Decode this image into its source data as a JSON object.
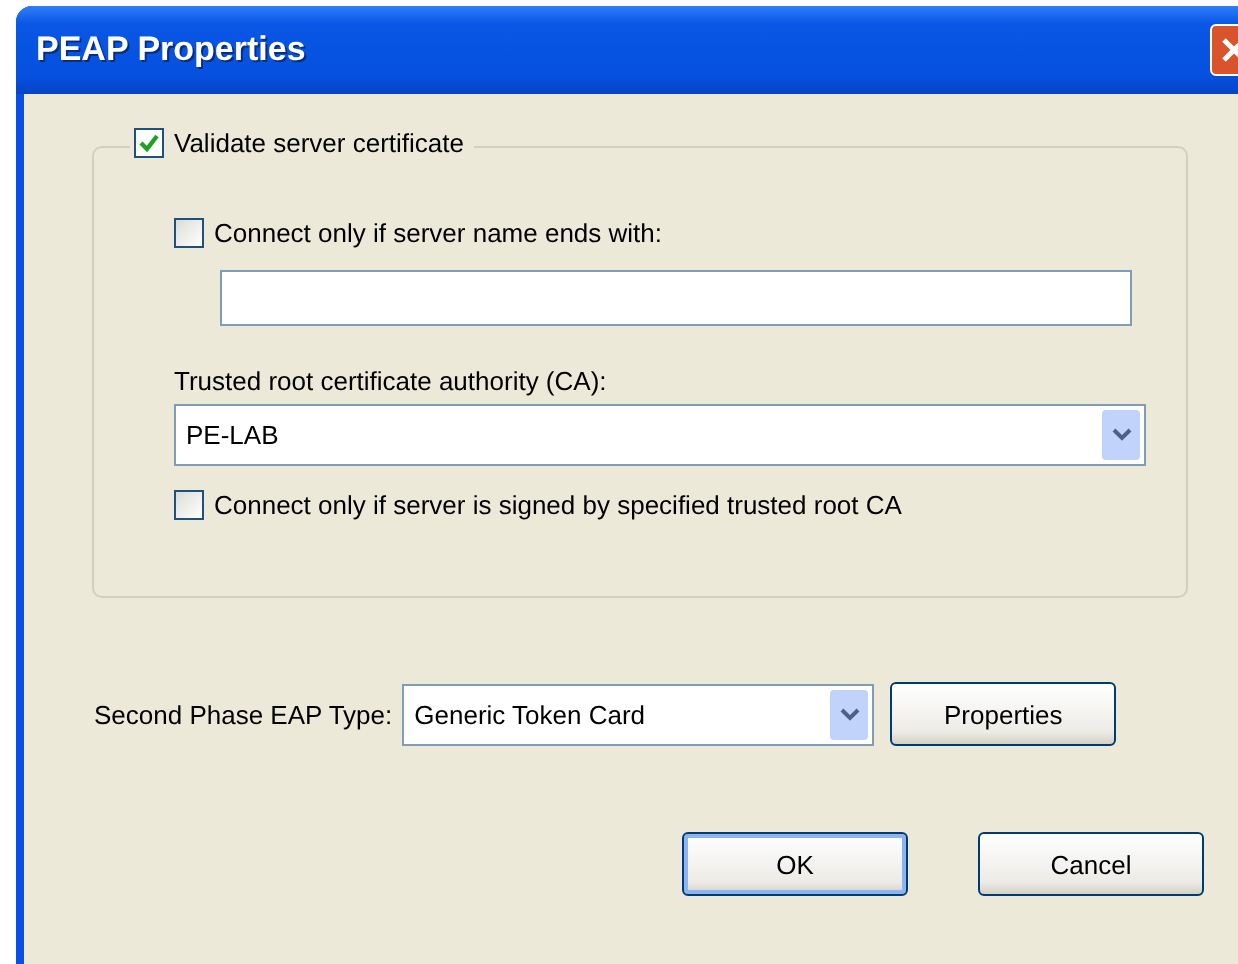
{
  "window": {
    "title": "PEAP Properties"
  },
  "validate": {
    "label": "Validate server certificate",
    "checked": true
  },
  "server_name": {
    "label": "Connect only if server name ends with:",
    "checked": false
  },
  "trusted_root": {
    "label": "Trusted root certificate authority (CA):",
    "value": "PE-LAB"
  },
  "signed_only": {
    "label": "Connect only if server is signed by specified trusted root CA",
    "checked": false
  },
  "second_phase": {
    "label": "Second Phase EAP Type:",
    "value": "Generic Token Card",
    "button": "Properties"
  },
  "buttons": [
    {
      "label": "OK",
      "default": true
    },
    {
      "label": "Cancel",
      "default": false
    }
  ]
}
